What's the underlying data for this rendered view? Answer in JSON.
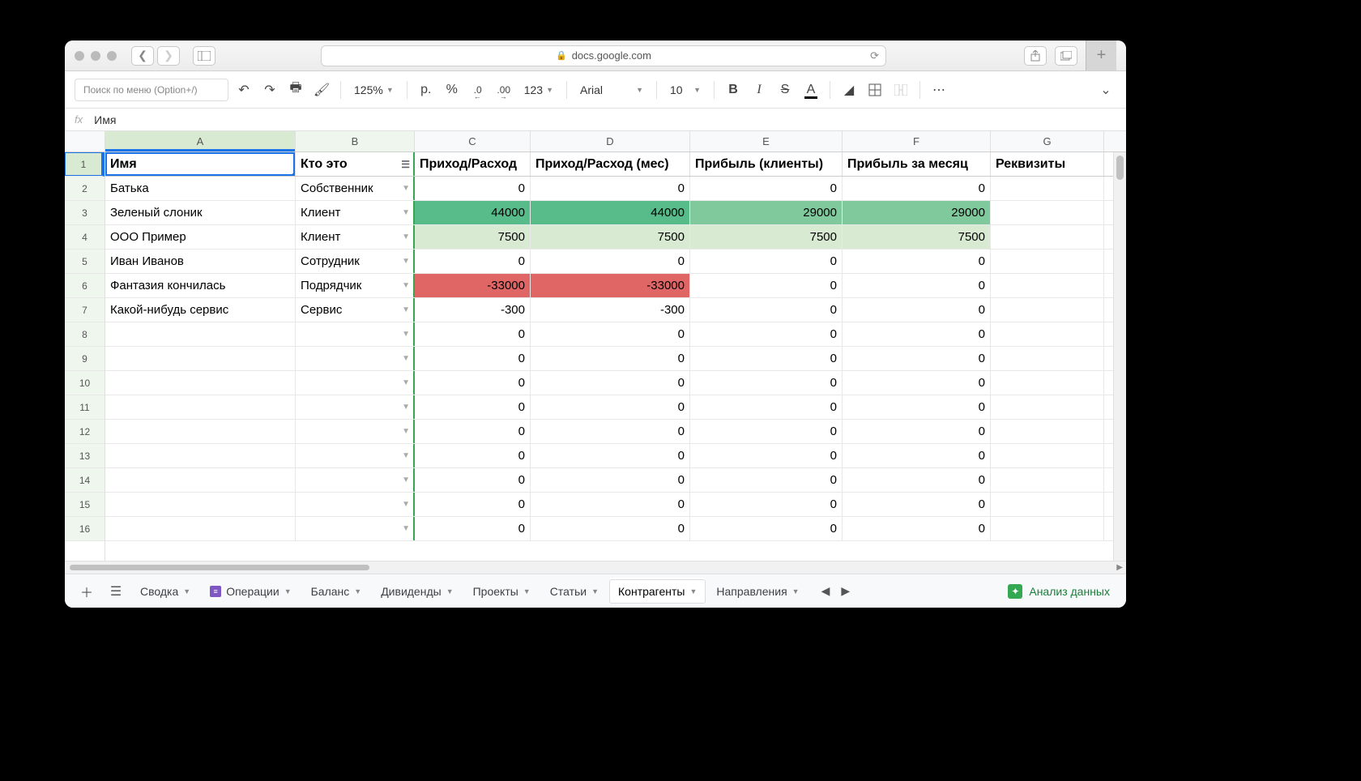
{
  "browser": {
    "url_host": "docs.google.com",
    "url_lock": true
  },
  "toolbar": {
    "search_placeholder": "Поиск по меню (Option+/)",
    "zoom": "125%",
    "currency": "р.",
    "percent": "%",
    "dec_less": ".0",
    "dec_more": ".00",
    "format_123": "123",
    "font": "Arial",
    "font_size": "10"
  },
  "formula_bar": {
    "fx": "fx",
    "value": "Имя"
  },
  "columns": [
    "A",
    "B",
    "C",
    "D",
    "E",
    "F",
    "G"
  ],
  "active_col": "A",
  "highlight_col": "B",
  "active_row": 1,
  "headers": {
    "A": "Имя",
    "B": "Кто это",
    "C": "Приход/Расход",
    "D": "Приход/Расход (мес)",
    "E": "Прибыль (клиенты)",
    "F": "Прибыль за месяц",
    "G": "Реквизиты"
  },
  "rows": [
    {
      "n": 2,
      "a": "Батька",
      "b": "Собственник",
      "c": "0",
      "d": "0",
      "e": "0",
      "f": "0"
    },
    {
      "n": 3,
      "a": "Зеленый слоник",
      "b": "Клиент",
      "c": "44000",
      "d": "44000",
      "e": "29000",
      "f": "29000",
      "c_cls": "bg-green-dark",
      "d_cls": "bg-green-dark",
      "e_cls": "bg-green-med",
      "f_cls": "bg-green-med"
    },
    {
      "n": 4,
      "a": "ООО Пример",
      "b": "Клиент",
      "c": "7500",
      "d": "7500",
      "e": "7500",
      "f": "7500",
      "c_cls": "bg-green-lite",
      "d_cls": "bg-green-lite",
      "e_cls": "bg-green-lite",
      "f_cls": "bg-green-lite"
    },
    {
      "n": 5,
      "a": "Иван Иванов",
      "b": "Сотрудник",
      "c": "0",
      "d": "0",
      "e": "0",
      "f": "0"
    },
    {
      "n": 6,
      "a": "Фантазия кончилась",
      "b": "Подрядчик",
      "c": "-33000",
      "d": "-33000",
      "e": "0",
      "f": "0",
      "c_cls": "bg-red",
      "d_cls": "bg-red"
    },
    {
      "n": 7,
      "a": "Какой-нибудь сервис",
      "b": "Сервис",
      "c": "-300",
      "d": "-300",
      "e": "0",
      "f": "0"
    },
    {
      "n": 8,
      "a": "",
      "b": "",
      "c": "0",
      "d": "0",
      "e": "0",
      "f": "0"
    },
    {
      "n": 9,
      "a": "",
      "b": "",
      "c": "0",
      "d": "0",
      "e": "0",
      "f": "0"
    },
    {
      "n": 10,
      "a": "",
      "b": "",
      "c": "0",
      "d": "0",
      "e": "0",
      "f": "0"
    },
    {
      "n": 11,
      "a": "",
      "b": "",
      "c": "0",
      "d": "0",
      "e": "0",
      "f": "0"
    },
    {
      "n": 12,
      "a": "",
      "b": "",
      "c": "0",
      "d": "0",
      "e": "0",
      "f": "0"
    },
    {
      "n": 13,
      "a": "",
      "b": "",
      "c": "0",
      "d": "0",
      "e": "0",
      "f": "0"
    },
    {
      "n": 14,
      "a": "",
      "b": "",
      "c": "0",
      "d": "0",
      "e": "0",
      "f": "0"
    },
    {
      "n": 15,
      "a": "",
      "b": "",
      "c": "0",
      "d": "0",
      "e": "0",
      "f": "0"
    },
    {
      "n": 16,
      "a": "",
      "b": "",
      "c": "0",
      "d": "0",
      "e": "0",
      "f": "0"
    }
  ],
  "sheets": {
    "tabs": [
      {
        "label": "Сводка",
        "badge": false
      },
      {
        "label": "Операции",
        "badge": true
      },
      {
        "label": "Баланс",
        "badge": false
      },
      {
        "label": "Дивиденды",
        "badge": false
      },
      {
        "label": "Проекты",
        "badge": false
      },
      {
        "label": "Статьи",
        "badge": false
      },
      {
        "label": "Контрагенты",
        "badge": false,
        "active": true
      },
      {
        "label": "Направления",
        "badge": false
      }
    ],
    "explore_label": "Анализ данных"
  }
}
